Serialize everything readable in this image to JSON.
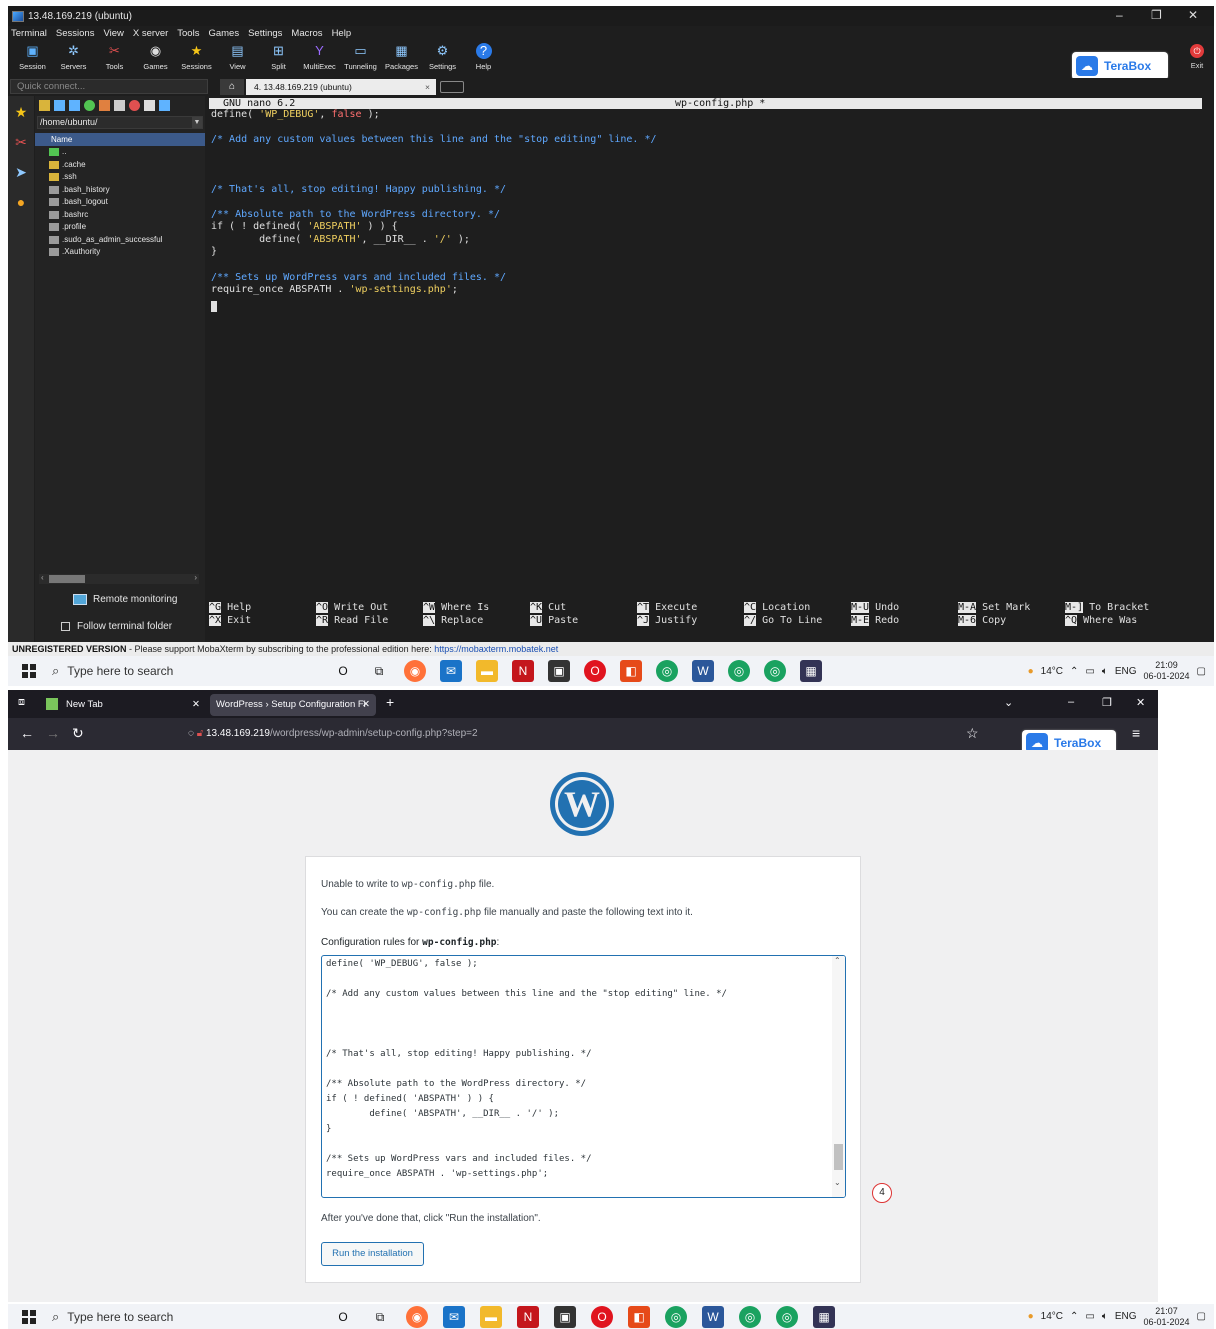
{
  "moba": {
    "title": "13.48.169.219 (ubuntu)",
    "menu": [
      "Terminal",
      "Sessions",
      "View",
      "X server",
      "Tools",
      "Games",
      "Settings",
      "Macros",
      "Help"
    ],
    "toolbar": [
      {
        "label": "Session",
        "icon": "session-icon"
      },
      {
        "label": "Servers",
        "icon": "servers-icon"
      },
      {
        "label": "Tools",
        "icon": "tools-icon"
      },
      {
        "label": "Games",
        "icon": "games-icon"
      },
      {
        "label": "Sessions",
        "icon": "star-icon"
      },
      {
        "label": "View",
        "icon": "view-icon"
      },
      {
        "label": "Split",
        "icon": "split-icon"
      },
      {
        "label": "MultiExec",
        "icon": "multiexec-icon"
      },
      {
        "label": "Tunneling",
        "icon": "tunneling-icon"
      },
      {
        "label": "Packages",
        "icon": "packages-icon"
      },
      {
        "label": "Settings",
        "icon": "settings-icon"
      },
      {
        "label": "Help",
        "icon": "help-icon"
      }
    ],
    "terabox_label": "TeraBox",
    "exit_label": "Exit",
    "quick_connect_placeholder": "Quick connect...",
    "tab_label": "4. 13.48.169.219 (ubuntu)",
    "sidebar": {
      "path": "/home/ubuntu/",
      "header": "Name",
      "items": [
        {
          "name": "..",
          "type": "up"
        },
        {
          "name": ".cache",
          "type": "folder"
        },
        {
          "name": ".ssh",
          "type": "folder"
        },
        {
          "name": ".bash_history",
          "type": "file"
        },
        {
          "name": ".bash_logout",
          "type": "file"
        },
        {
          "name": ".bashrc",
          "type": "file"
        },
        {
          "name": ".profile",
          "type": "file"
        },
        {
          "name": ".sudo_as_admin_successful",
          "type": "file"
        },
        {
          "name": ".Xauthority",
          "type": "file"
        }
      ],
      "remote_monitoring": "Remote monitoring",
      "follow_folder": "Follow terminal folder"
    },
    "nano": {
      "version": "GNU nano 6.2",
      "filename": "wp-config.php *",
      "shortcuts": [
        {
          "k1": "^G",
          "l1": "Help",
          "k2": "^X",
          "l2": "Exit"
        },
        {
          "k1": "^O",
          "l1": "Write Out",
          "k2": "^R",
          "l2": "Read File"
        },
        {
          "k1": "^W",
          "l1": "Where Is",
          "k2": "^\\",
          "l2": "Replace"
        },
        {
          "k1": "^K",
          "l1": "Cut",
          "k2": "^U",
          "l2": "Paste"
        },
        {
          "k1": "^T",
          "l1": "Execute",
          "k2": "^J",
          "l2": "Justify"
        },
        {
          "k1": "^C",
          "l1": "Location",
          "k2": "^/",
          "l2": "Go To Line"
        },
        {
          "k1": "M-U",
          "l1": "Undo",
          "k2": "M-E",
          "l2": "Redo"
        },
        {
          "k1": "M-A",
          "l1": "Set Mark",
          "k2": "M-6",
          "l2": "Copy"
        },
        {
          "k1": "M-]",
          "l1": "To Bracket",
          "k2": "^Q",
          "l2": "Where Was"
        }
      ]
    },
    "status": {
      "bold": "UNREGISTERED VERSION",
      "text": " -  Please support MobaXterm by subscribing to the professional edition here: ",
      "link": "https://mobaxterm.mobatek.net"
    }
  },
  "code_lines": [
    "define( 'WP_DEBUG', false );",
    "",
    "/* Add any custom values between this line and the \"stop editing\" line. */",
    "",
    "",
    "",
    "/* That's all, stop editing! Happy publishing. */",
    "",
    "/** Absolute path to the WordPress directory. */",
    "if ( ! defined( 'ABSPATH' ) ) {",
    "        define( 'ABSPATH', __DIR__ . '/' );",
    "}",
    "",
    "/** Sets up WordPress vars and included files. */",
    "require_once ABSPATH . 'wp-settings.php';"
  ],
  "taskbar_top": {
    "search_placeholder": "Type here to search",
    "temp": "14°C",
    "lang": "ENG",
    "time": "21:09",
    "date": "06-01-2024"
  },
  "taskbar_bottom": {
    "search_placeholder": "Type here to search",
    "temp": "14°C",
    "lang": "ENG",
    "time": "21:07",
    "date": "06-01-2024"
  },
  "firefox": {
    "tab1": "New Tab",
    "tab2": "WordPress › Setup Configuration Fi",
    "url_host": "13.48.169.219",
    "url_rest": "/wordpress/wp-admin/setup-config.php?step=2",
    "terabox_label": "TeraBox"
  },
  "wp": {
    "unable_prefix": "Unable to write to ",
    "unable_code": "wp-config.php",
    "unable_suffix": " file.",
    "create_prefix": "You can create the ",
    "create_code": "wp-config.php",
    "create_suffix": " file manually and paste the following text into it.",
    "rules_prefix": "Configuration rules for ",
    "rules_code": "wp-config.php",
    "rules_suffix": ":",
    "after_text": "After you've done that, click \"Run the installation\".",
    "run_button": "Run the installation",
    "step_badge": "4"
  }
}
